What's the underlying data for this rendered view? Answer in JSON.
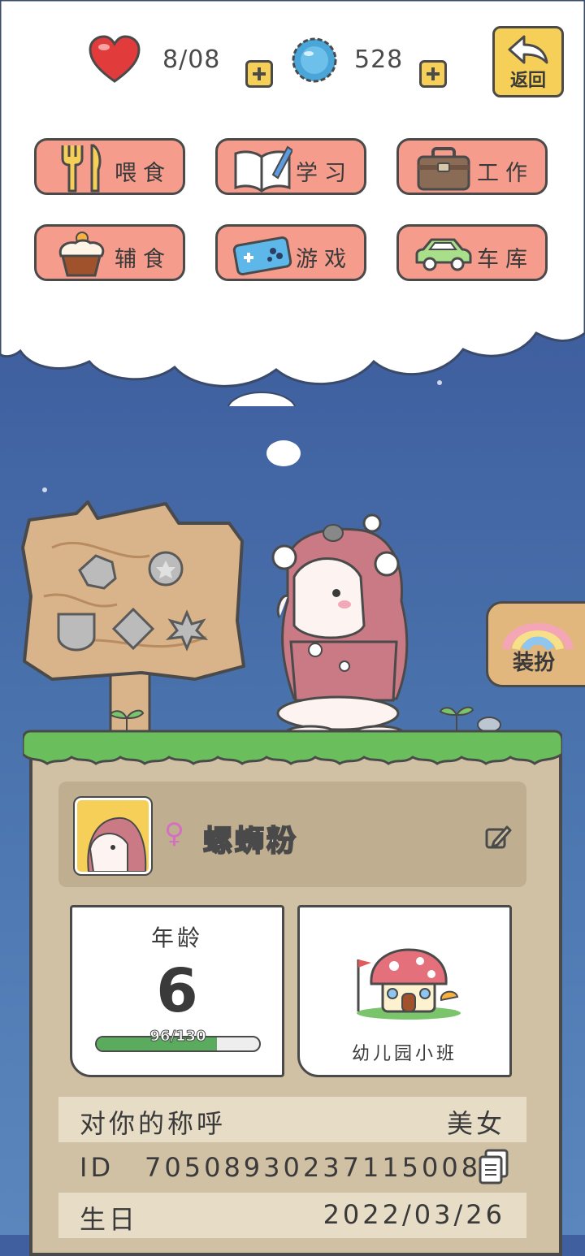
{
  "status": {
    "hearts": "8/08",
    "coins": "528"
  },
  "back_label": "返回",
  "actions": [
    {
      "label": "喂食",
      "icon": "fork-knife-icon"
    },
    {
      "label": "学习",
      "icon": "book-pen-icon"
    },
    {
      "label": "工作",
      "icon": "briefcase-icon"
    },
    {
      "label": "辅食",
      "icon": "cupcake-icon"
    },
    {
      "label": "游戏",
      "icon": "gamepad-icon"
    },
    {
      "label": "车库",
      "icon": "car-icon"
    }
  ],
  "dress_up_label": "装扮",
  "profile": {
    "gender_symbol": "♀",
    "name": "螺蛳粉"
  },
  "age_card": {
    "title": "年龄",
    "age": "6",
    "progress_text": "96/130",
    "progress": 0.738
  },
  "school_card": {
    "label": "幼儿园小班"
  },
  "info_rows": {
    "nickname_label": "对你的称呼",
    "nickname_value": "美女",
    "id_label": "ID",
    "id_value": "70508930237115008",
    "birthday_label": "生日",
    "birthday_value": "2022/03/26"
  },
  "colors": {
    "sky": "#3f5f9f",
    "button": "#f59c8d",
    "panel": "#d0c1a4",
    "yellow": "#f6cf58",
    "grass": "#5fb65a"
  }
}
